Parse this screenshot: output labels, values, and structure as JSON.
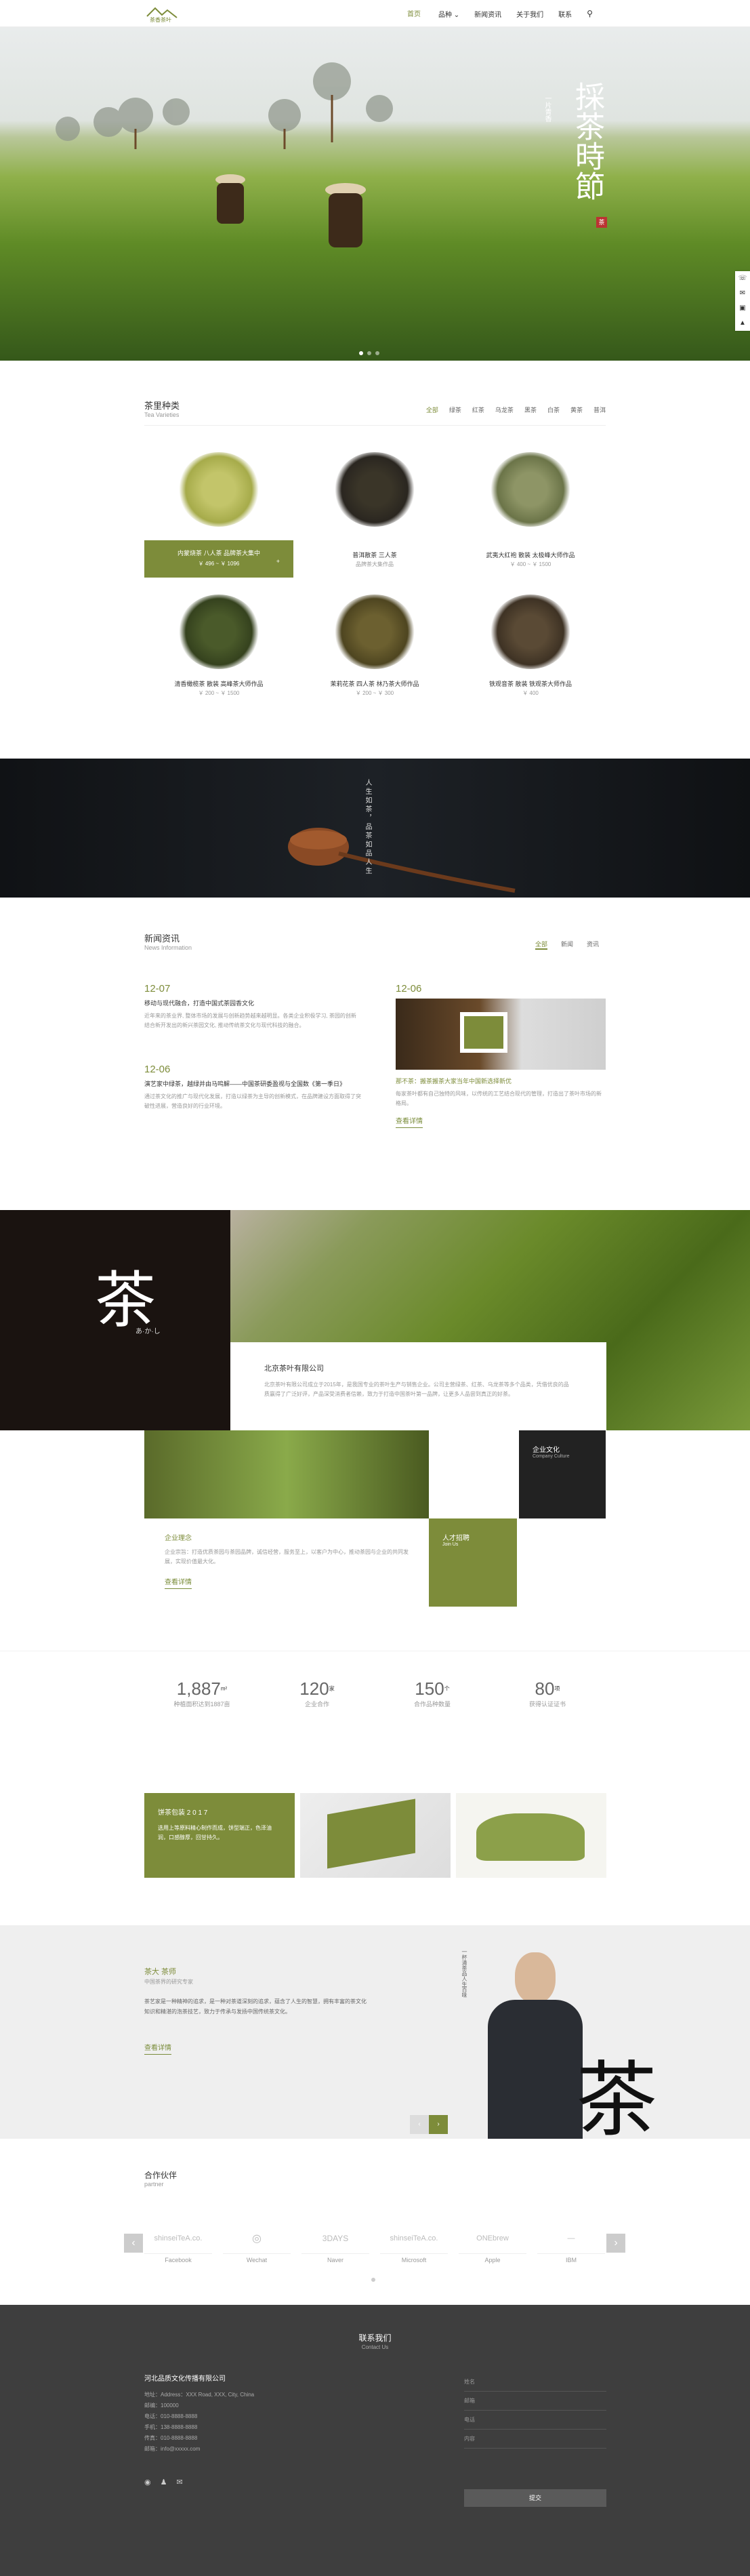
{
  "header": {
    "logo_text": "茶香茶叶",
    "nav": [
      {
        "label": "首页",
        "active": true
      },
      {
        "label": "品种 ⌄"
      },
      {
        "label": "新闻资讯"
      },
      {
        "label": "关于我们"
      },
      {
        "label": "联系"
      }
    ]
  },
  "hero": {
    "title": "採茶時節",
    "sub": "一片青香",
    "seal": "茶"
  },
  "products": {
    "title": "茶里种类",
    "subtitle": "Tea Varieties",
    "tabs": [
      "全部",
      "绿茶",
      "红茶",
      "乌龙茶",
      "黑茶",
      "白茶",
      "黄茶",
      "普洱"
    ],
    "items": [
      {
        "name": "内蒙烧茶 八人茶 品牌茶大集中",
        "price": "￥ 496 ~ ￥ 1096"
      },
      {
        "name": "普洱散茶 三人茶",
        "price": "品牌茶大集作品"
      },
      {
        "name": "武夷大红袍 散装 太极峰大师作品",
        "price": "￥ 400 ~ ￥ 1500"
      },
      {
        "name": "清香橄榄茶 散装 高峰茶大师作品",
        "price": "￥ 200 ~ ￥ 1500"
      },
      {
        "name": "茉莉花茶 四人茶 林乃茶大师作品",
        "price": "￥ 200 ~ ￥ 300"
      },
      {
        "name": "铁观音茶 散装 铁观茶大师作品",
        "price": "￥ 400"
      }
    ]
  },
  "banner": {
    "text": "人生如茶，品茶如品人生"
  },
  "news": {
    "title": "新闻资讯",
    "subtitle": "News Information",
    "tabs": [
      "全部",
      "新闻",
      "资讯"
    ],
    "items": [
      {
        "date": "12-07",
        "title": "移动与现代融合，打造中国式茶园香文化",
        "body": "近年来的茶业界, 整体市场的发展与创新趋势越来越明显。各类企业积极学习, 茶园的创新结合新开发出的新兴茶园文化, 推动传统茶文化与现代科技的融合。"
      },
      {
        "date": "12-06",
        "title": "演艺家中绿茶，越绿并由马鸣解——中国茶研委盈视与全国数《第一季日》",
        "body": "通过茶文化的推广与现代化发展，打造以绿茶为主导的创新模式，在品牌建设方面取得了突破性进展，营造良好的行业环境。"
      },
      {
        "date": "12-06",
        "title": "那不茶：搬茶搬茶大家当年中国新选择新优",
        "body": "每家茶叶都有自己独特的风味，以传统的工艺结合现代的管理，打造出了茶叶市场的新格局。"
      }
    ],
    "more": "查看详情"
  },
  "about": {
    "calligraphy": "茶",
    "caption": "あ·か·し",
    "company": "北京茶叶有限公司",
    "company_desc": "北京茶叶有限公司成立于2015年，是我国专业的茶叶生产与销售企业。公司主营绿茶、红茶、乌龙茶等多个品类，凭借优良的品质赢得了广泛好评，产品深受消费者信赖，致力于打造中国茶叶第一品牌，让更多人品尝到真正的好茶。",
    "culture": "企业文化",
    "culture_en": "Company Culture",
    "idea": "企业理念",
    "idea_desc": "企业宗旨：打造优质茶园与茶园品牌，诚信经营，服务至上，以客户为中心，推动茶园与企业的共同发展，实现价值最大化。",
    "talent": "人才招聘",
    "talent_en": "Join Us",
    "more": "查看详情"
  },
  "stats": [
    {
      "num": "1,887",
      "unit": "m²",
      "label": "种植面积达到1887亩"
    },
    {
      "num": "120",
      "unit": "家",
      "label": "企业合作"
    },
    {
      "num": "150",
      "unit": "个",
      "label": "合作品种数量"
    },
    {
      "num": "80",
      "unit": "项",
      "label": "获得认证证书"
    }
  ],
  "feature": {
    "title": "饼茶包装 2 0 1 7",
    "body": "选用上等原料精心制作而成，饼型端正，色泽油润，口感醇厚，回甘持久。"
  },
  "master": {
    "name": "茶大 茶师",
    "title": "中国茶界的研究专家",
    "body": "茶艺家是一种精神的追求，是一种对茶道深刻的追求，蕴含了人生的智慧，拥有丰富的茶文化知识和精湛的泡茶技艺，致力于传承与发扬中国传统茶文化。",
    "more": "查看详情",
    "vertical": "一杯清茶品人生百味",
    "char": "茶"
  },
  "partners": {
    "title": "合作伙伴",
    "subtitle": "partner",
    "items": [
      {
        "logo": "shinseiTeA.co.",
        "name": "Facebook"
      },
      {
        "logo": "◎",
        "name": "Wechat"
      },
      {
        "logo": "3DAYS",
        "name": "Naver"
      },
      {
        "logo": "shinseiTeA.co.",
        "name": "Microsoft"
      },
      {
        "logo": "ONEbrew",
        "name": "Apple"
      },
      {
        "logo": "—",
        "name": "IBM"
      }
    ]
  },
  "footer": {
    "title": "联系我们",
    "subtitle": "Contact Us",
    "company": "河北品质文化传播有限公司",
    "lines": [
      "地址：Address：XXX Road, XXX, City, China",
      "邮编：100000",
      "电话：010-8888-8888",
      "手机：138-8888-8888",
      "传真：010-8888-8888",
      "邮箱：info@xxxxx.com"
    ],
    "fields": [
      "姓名",
      "邮箱",
      "电话",
      "内容"
    ],
    "submit": "提交"
  },
  "colors": {
    "accent": "#7d8c3a",
    "dark": "#3e3e3e"
  }
}
